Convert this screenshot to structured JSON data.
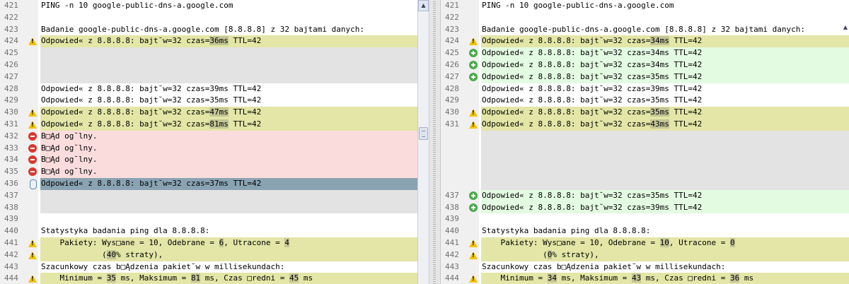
{
  "left_pane": {
    "lines": [
      {
        "num": "421",
        "type": "plain",
        "icon": null,
        "segments": [
          "PING -n 10 google-public-dns-a.google.com"
        ]
      },
      {
        "num": "422",
        "type": "plain",
        "icon": null,
        "segments": [
          ""
        ]
      },
      {
        "num": "423",
        "type": "plain",
        "icon": null,
        "segments": [
          "Badanie google-public-dns-a.google.com [8.8.8.8] z 32 bajtami danych:"
        ]
      },
      {
        "num": "424",
        "type": "warn",
        "icon": "warning-icon",
        "segments": [
          "Odpowied« z 8.8.8.8: bajt˘w=32 czas=",
          {
            "hl": "36ms"
          },
          " TTL=42"
        ]
      },
      {
        "num": "425",
        "type": "empty",
        "icon": null,
        "segments": [
          ""
        ]
      },
      {
        "num": "426",
        "type": "empty",
        "icon": null,
        "segments": [
          ""
        ]
      },
      {
        "num": "427",
        "type": "empty",
        "icon": null,
        "segments": [
          ""
        ]
      },
      {
        "num": "428",
        "type": "plain",
        "icon": null,
        "segments": [
          "Odpowied« z 8.8.8.8: bajt˘w=32 czas=39ms TTL=42"
        ]
      },
      {
        "num": "429",
        "type": "plain",
        "icon": null,
        "segments": [
          "Odpowied« z 8.8.8.8: bajt˘w=32 czas=35ms TTL=42"
        ]
      },
      {
        "num": "430",
        "type": "warn",
        "icon": "warning-icon",
        "segments": [
          "Odpowied« z 8.8.8.8: bajt˘w=32 czas=",
          {
            "hl": "47ms"
          },
          " TTL=42"
        ]
      },
      {
        "num": "431",
        "type": "warn",
        "icon": "warning-icon",
        "segments": [
          "Odpowied« z 8.8.8.8: bajt˘w=32 czas=",
          {
            "hl": "81ms"
          },
          " TTL=42"
        ]
      },
      {
        "num": "432",
        "type": "err",
        "icon": "error-icon",
        "segments": [
          "B□Ąd og˘lny."
        ]
      },
      {
        "num": "433",
        "type": "err",
        "icon": "error-icon",
        "segments": [
          "B□Ąd og˘lny."
        ]
      },
      {
        "num": "434",
        "type": "err",
        "icon": "error-icon",
        "segments": [
          "B□Ąd og˘lny."
        ]
      },
      {
        "num": "435",
        "type": "err",
        "icon": "error-icon",
        "segments": [
          "B□Ąd og˘lny."
        ]
      },
      {
        "num": "436",
        "type": "sel",
        "icon": "sync-icon",
        "segments": [
          "Odpowied« z 8.8.8.8: bajt˘w=32 czas=37ms TTL=42"
        ]
      },
      {
        "num": "437",
        "type": "empty",
        "icon": null,
        "segments": [
          ""
        ]
      },
      {
        "num": "438",
        "type": "empty",
        "icon": null,
        "segments": [
          ""
        ]
      },
      {
        "num": "439",
        "type": "plain",
        "icon": null,
        "segments": [
          ""
        ]
      },
      {
        "num": "440",
        "type": "plain",
        "icon": null,
        "segments": [
          "Statystyka badania ping dla 8.8.8.8:"
        ]
      },
      {
        "num": "441",
        "type": "warn",
        "icon": "warning-icon",
        "segments": [
          "    Pakiety: Wys□ane = 10, Odebrane = ",
          {
            "hl": "6"
          },
          ", Utracone = ",
          {
            "hl": "4"
          }
        ]
      },
      {
        "num": "442",
        "type": "warn",
        "icon": "warning-icon",
        "segments": [
          "             (",
          {
            "hl": "40"
          },
          "% straty),"
        ]
      },
      {
        "num": "443",
        "type": "plain",
        "icon": null,
        "segments": [
          "Szacunkowy czas b□Ądzenia pakiet˘w w millisekundach:"
        ]
      },
      {
        "num": "444",
        "type": "warn",
        "icon": "warning-icon",
        "segments": [
          "    Minimum = ",
          {
            "hl": "35"
          },
          " ms, Maksimum = ",
          {
            "hl": "81"
          },
          " ms, Czas □redni = ",
          {
            "hl": "45"
          },
          " ms"
        ]
      }
    ]
  },
  "right_pane": {
    "lines": [
      {
        "num": "421",
        "type": "plain",
        "icon": null,
        "segments": [
          "PING -n 10 google-public-dns-a.google.com"
        ]
      },
      {
        "num": "422",
        "type": "plain",
        "icon": null,
        "segments": [
          ""
        ]
      },
      {
        "num": "423",
        "type": "plain",
        "icon": null,
        "segments": [
          "Badanie google-public-dns-a.google.com [8.8.8.8] z 32 bajtami danych:"
        ]
      },
      {
        "num": "424",
        "type": "warn",
        "icon": "warning-icon",
        "segments": [
          "Odpowied« z 8.8.8.8: bajt˘w=32 czas=",
          {
            "hl": "34ms"
          },
          " TTL=42"
        ]
      },
      {
        "num": "425",
        "type": "added",
        "icon": "add-icon",
        "segments": [
          "Odpowied« z 8.8.8.8: bajt˘w=32 czas=34ms TTL=42"
        ]
      },
      {
        "num": "426",
        "type": "added",
        "icon": "add-icon",
        "segments": [
          "Odpowied« z 8.8.8.8: bajt˘w=32 czas=34ms TTL=42"
        ]
      },
      {
        "num": "427",
        "type": "added",
        "icon": "add-icon",
        "segments": [
          "Odpowied« z 8.8.8.8: bajt˘w=32 czas=35ms TTL=42"
        ]
      },
      {
        "num": "428",
        "type": "plain",
        "icon": null,
        "segments": [
          "Odpowied« z 8.8.8.8: bajt˘w=32 czas=39ms TTL=42"
        ]
      },
      {
        "num": "429",
        "type": "plain",
        "icon": null,
        "segments": [
          "Odpowied« z 8.8.8.8: bajt˘w=32 czas=35ms TTL=42"
        ]
      },
      {
        "num": "430",
        "type": "warn",
        "icon": "warning-icon",
        "segments": [
          "Odpowied« z 8.8.8.8: bajt˘w=32 czas=",
          {
            "hl": "35ms"
          },
          " TTL=42"
        ]
      },
      {
        "num": "431",
        "type": "warn",
        "icon": "warning-icon",
        "segments": [
          "Odpowied« z 8.8.8.8: bajt˘w=32 czas=",
          {
            "hl": "43ms"
          },
          " TTL=42"
        ]
      },
      {
        "num": "",
        "type": "empty",
        "icon": null,
        "segments": [
          ""
        ]
      },
      {
        "num": "",
        "type": "empty",
        "icon": null,
        "segments": [
          ""
        ]
      },
      {
        "num": "",
        "type": "empty",
        "icon": null,
        "segments": [
          ""
        ]
      },
      {
        "num": "",
        "type": "empty",
        "icon": null,
        "segments": [
          ""
        ]
      },
      {
        "num": "",
        "type": "empty",
        "icon": null,
        "segments": [
          ""
        ]
      },
      {
        "num": "437",
        "type": "added",
        "icon": "add-icon",
        "segments": [
          "Odpowied« z 8.8.8.8: bajt˘w=32 czas=35ms TTL=42"
        ]
      },
      {
        "num": "438",
        "type": "added",
        "icon": "add-icon",
        "segments": [
          "Odpowied« z 8.8.8.8: bajt˘w=32 czas=39ms TTL=42"
        ]
      },
      {
        "num": "439",
        "type": "plain",
        "icon": null,
        "segments": [
          ""
        ]
      },
      {
        "num": "440",
        "type": "plain",
        "icon": null,
        "segments": [
          "Statystyka badania ping dla 8.8.8.8:"
        ]
      },
      {
        "num": "441",
        "type": "warn",
        "icon": "warning-icon",
        "segments": [
          "    Pakiety: Wys□ane = 10, Odebrane = ",
          {
            "hl": "10"
          },
          ", Utracone = ",
          {
            "hl": "0"
          }
        ]
      },
      {
        "num": "442",
        "type": "warn",
        "icon": "warning-icon",
        "segments": [
          "             (",
          {
            "hl": "0"
          },
          "% straty),"
        ]
      },
      {
        "num": "443",
        "type": "plain",
        "icon": null,
        "segments": [
          "Szacunkowy czas b□Ądzenia pakiet˘w w millisekundach:"
        ]
      },
      {
        "num": "444",
        "type": "warn",
        "icon": "warning-icon",
        "segments": [
          "    Minimum = ",
          {
            "hl": "34"
          },
          " ms, Maksimum = ",
          {
            "hl": "43"
          },
          " ms, Czas □redni = ",
          {
            "hl": "36"
          },
          " ms"
        ]
      }
    ]
  },
  "scrollbar": {
    "up_arrow": "▲"
  },
  "colors": {
    "warning": "#e3e6a6",
    "error": "#fbdcdc",
    "added": "#e3fbe1",
    "selected": "#8aa3b2",
    "empty": "#e3e3e3"
  }
}
